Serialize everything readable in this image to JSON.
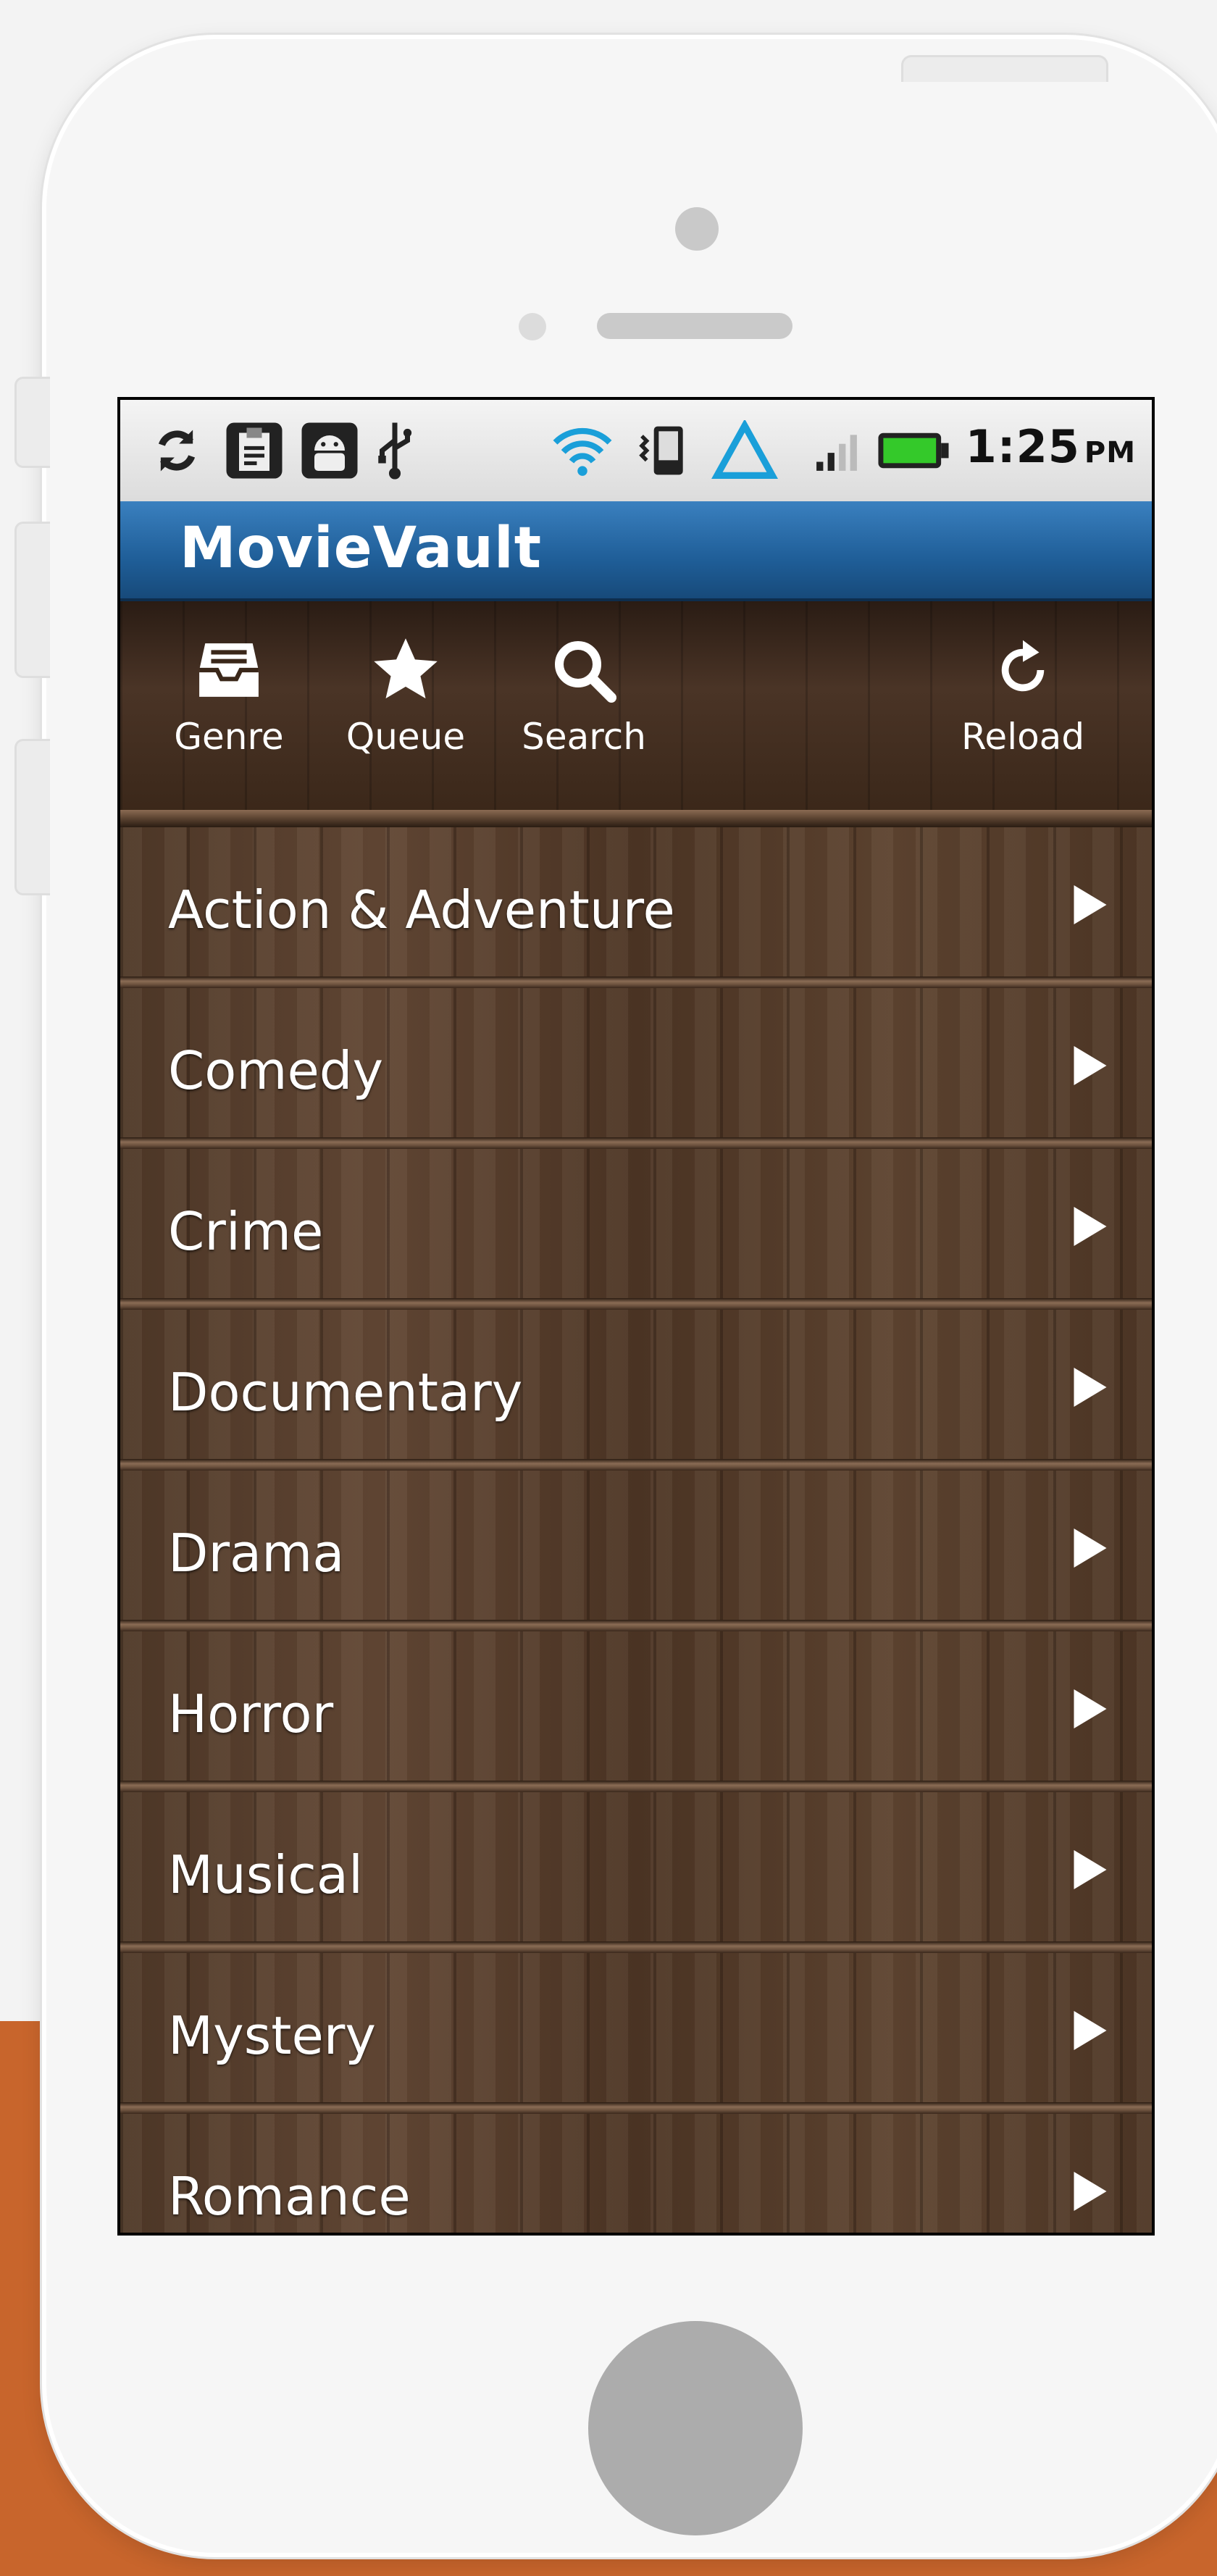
{
  "app": {
    "title": "MovieVault",
    "time": "1:25",
    "meridiem": "PM"
  },
  "status_icons": [
    "sync-icon",
    "clipboard-icon",
    "android-debug-icon",
    "usb-icon",
    "wifi-icon",
    "vibrate-icon",
    "triangle-alert-icon",
    "signal-icon",
    "battery-icon"
  ],
  "toolbar": {
    "items": [
      {
        "label": "Genre",
        "icon": "inbox-icon"
      },
      {
        "label": "Queue",
        "icon": "star-icon"
      },
      {
        "label": "Search",
        "icon": "search-icon"
      },
      {
        "label": "Reload",
        "icon": "reload-icon"
      }
    ]
  },
  "genres": [
    {
      "label": "Action & Adventure"
    },
    {
      "label": "Comedy"
    },
    {
      "label": "Crime"
    },
    {
      "label": "Documentary"
    },
    {
      "label": "Drama"
    },
    {
      "label": "Horror"
    },
    {
      "label": "Musical"
    },
    {
      "label": "Mystery"
    },
    {
      "label": "Romance"
    }
  ],
  "colors": {
    "title_bar": "#1f5e98",
    "page_accent": "#c8652c",
    "wood": "#5e4432"
  }
}
